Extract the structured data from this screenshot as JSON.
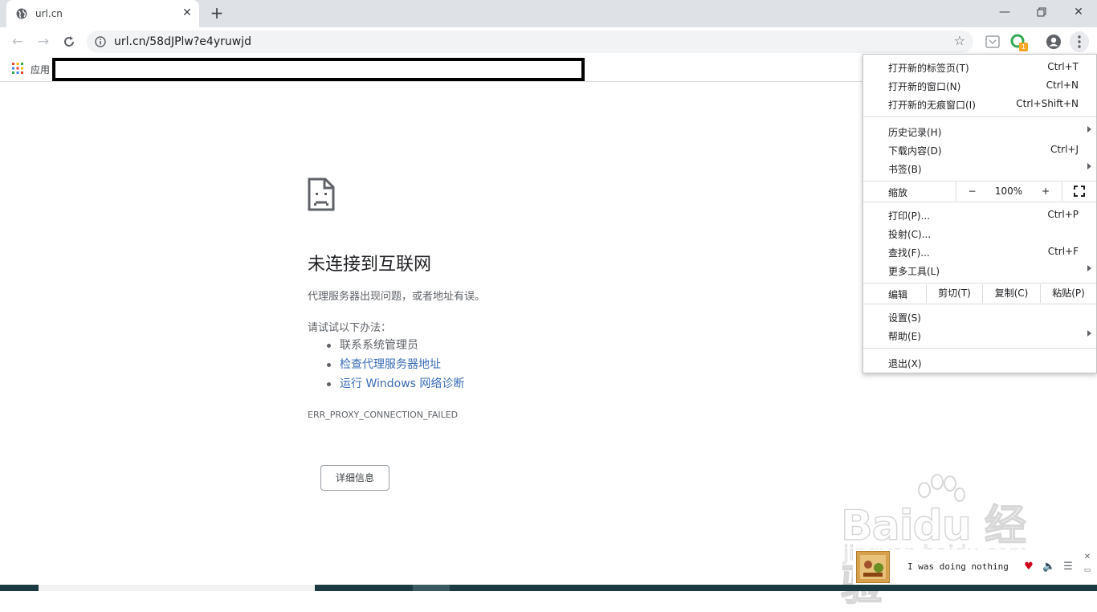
{
  "browser": {
    "tab": {
      "title": "url.cn"
    },
    "address": {
      "url": "url.cn/58dJPlw?e4yruwjd"
    },
    "bookmarks": {
      "apps_label": "应用"
    }
  },
  "error_page": {
    "title": "未连接到互联网",
    "subtitle": "代理服务器出现问题，或者地址有误。",
    "try_label": "请试试以下办法：",
    "suggestions": [
      "联系系统管理员",
      "检查代理服务器地址",
      "运行 Windows 网络诊断"
    ],
    "error_code": "ERR_PROXY_CONNECTION_FAILED",
    "details_button": "详细信息"
  },
  "menu": {
    "new_tab": {
      "label": "打开新的标签页(T)",
      "shortcut": "Ctrl+T"
    },
    "new_window": {
      "label": "打开新的窗口(N)",
      "shortcut": "Ctrl+N"
    },
    "incognito": {
      "label": "打开新的无痕窗口(I)",
      "shortcut": "Ctrl+Shift+N"
    },
    "history": {
      "label": "历史记录(H)"
    },
    "downloads": {
      "label": "下载内容(D)",
      "shortcut": "Ctrl+J"
    },
    "bookmarks": {
      "label": "书签(B)"
    },
    "zoom": {
      "label": "缩放",
      "minus": "−",
      "value": "100%",
      "plus": "+"
    },
    "print": {
      "label": "打印(P)...",
      "shortcut": "Ctrl+P"
    },
    "cast": {
      "label": "投射(C)..."
    },
    "find": {
      "label": "查找(F)...",
      "shortcut": "Ctrl+F"
    },
    "more_tools": {
      "label": "更多工具(L)"
    },
    "edit": {
      "label": "编辑",
      "cut": "剪切(T)",
      "copy": "复制(C)",
      "paste": "粘贴(P)"
    },
    "settings": {
      "label": "设置(S)"
    },
    "help": {
      "label": "帮助(E)"
    },
    "exit": {
      "label": "退出(X)"
    }
  },
  "extension_badge": "1",
  "player": {
    "song": "I was doing nothing"
  },
  "colors": {
    "link": "#3a6cb8",
    "tab_strip": "#dee1e6",
    "taskbar": "#1b3a42"
  }
}
